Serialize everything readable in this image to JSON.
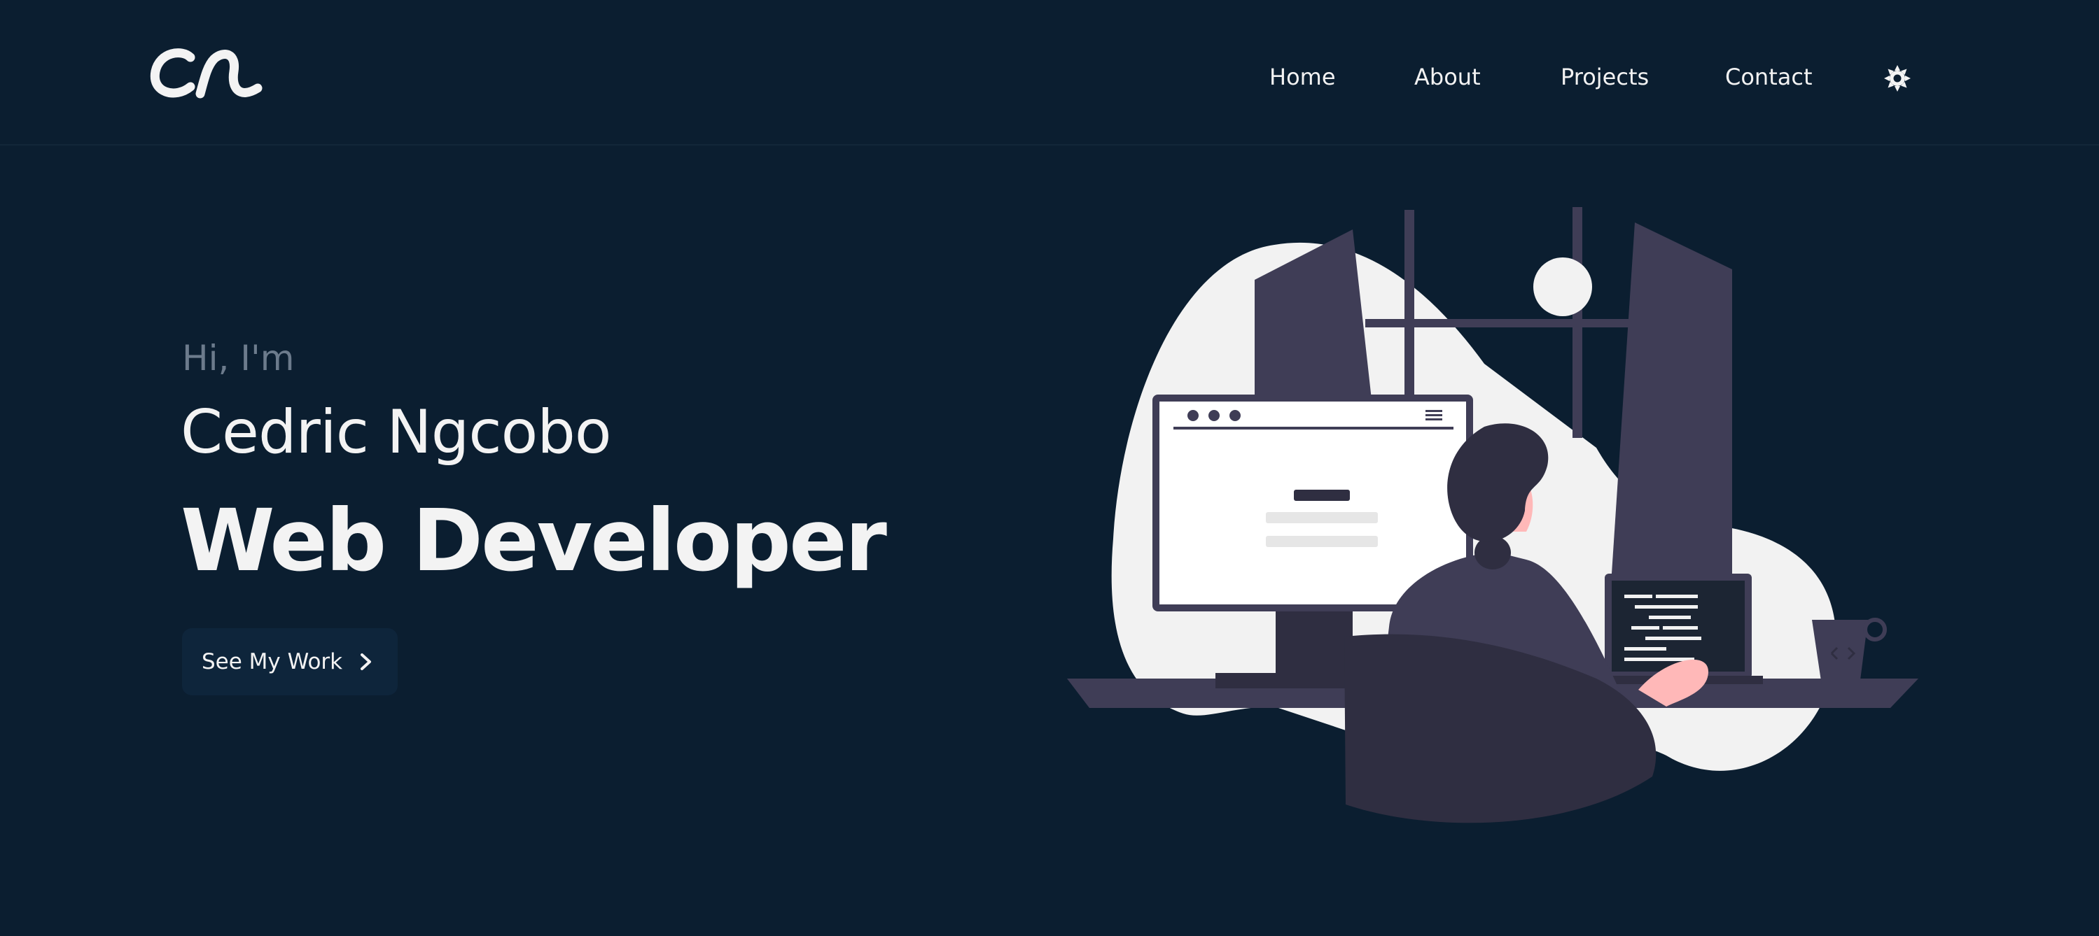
{
  "navbar": {
    "logo_text": "cn",
    "links": [
      {
        "label": "Home"
      },
      {
        "label": "About"
      },
      {
        "label": "Projects"
      },
      {
        "label": "Contact"
      }
    ],
    "theme_toggle_icon": "sun-icon"
  },
  "hero": {
    "greeting": "Hi, I'm",
    "name": "Cedric Ngcobo",
    "role": "Web Developer",
    "cta_label": "See My Work",
    "cta_icon": "chevron-right-icon"
  },
  "illustration": {
    "subject": "developer-at-desk"
  },
  "colors": {
    "background": "#0b1e30",
    "text": "#f3f3f3",
    "muted": "#6c7b8c",
    "button_bg": "#0e253b",
    "illustration_dark": "#3f3d56",
    "illustration_light": "#f2f2f2",
    "skin": "#ffb8b8"
  }
}
